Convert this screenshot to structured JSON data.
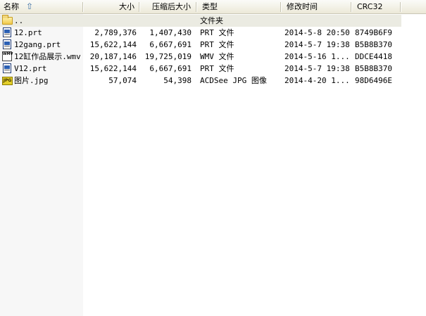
{
  "columns": {
    "name": "名称",
    "size": "大小",
    "compressed": "压缩后大小",
    "type": "类型",
    "modified": "修改时间",
    "crc": "CRC32"
  },
  "parent_row": {
    "name": "..",
    "type": "文件夹"
  },
  "files": [
    {
      "name": "12.prt",
      "size": "2,789,376",
      "compressed": "1,407,430",
      "type": "PRT 文件",
      "modified": "2014-5-8 20:50",
      "crc": "8749B6F9",
      "icon": "prt-file-icon"
    },
    {
      "name": "12gang.prt",
      "size": "15,622,144",
      "compressed": "6,667,691",
      "type": "PRT 文件",
      "modified": "2014-5-7 19:38",
      "crc": "B5B8B370",
      "icon": "prt-file-icon"
    },
    {
      "name": "12缸作品展示.wmv",
      "size": "20,187,146",
      "compressed": "19,725,019",
      "type": "WMV 文件",
      "modified": "2014-5-16 1...",
      "crc": "DDCE4418",
      "icon": "wmv-file-icon"
    },
    {
      "name": "V12.prt",
      "size": "15,622,144",
      "compressed": "6,667,691",
      "type": "PRT 文件",
      "modified": "2014-5-7 19:38",
      "crc": "B5B8B370",
      "icon": "prt-file-icon"
    },
    {
      "name": "图片.jpg",
      "size": "57,074",
      "compressed": "54,398",
      "type": "ACDSee JPG 图像",
      "modified": "2014-4-20 1...",
      "crc": "98D6496E",
      "icon": "jpg-file-icon"
    }
  ]
}
